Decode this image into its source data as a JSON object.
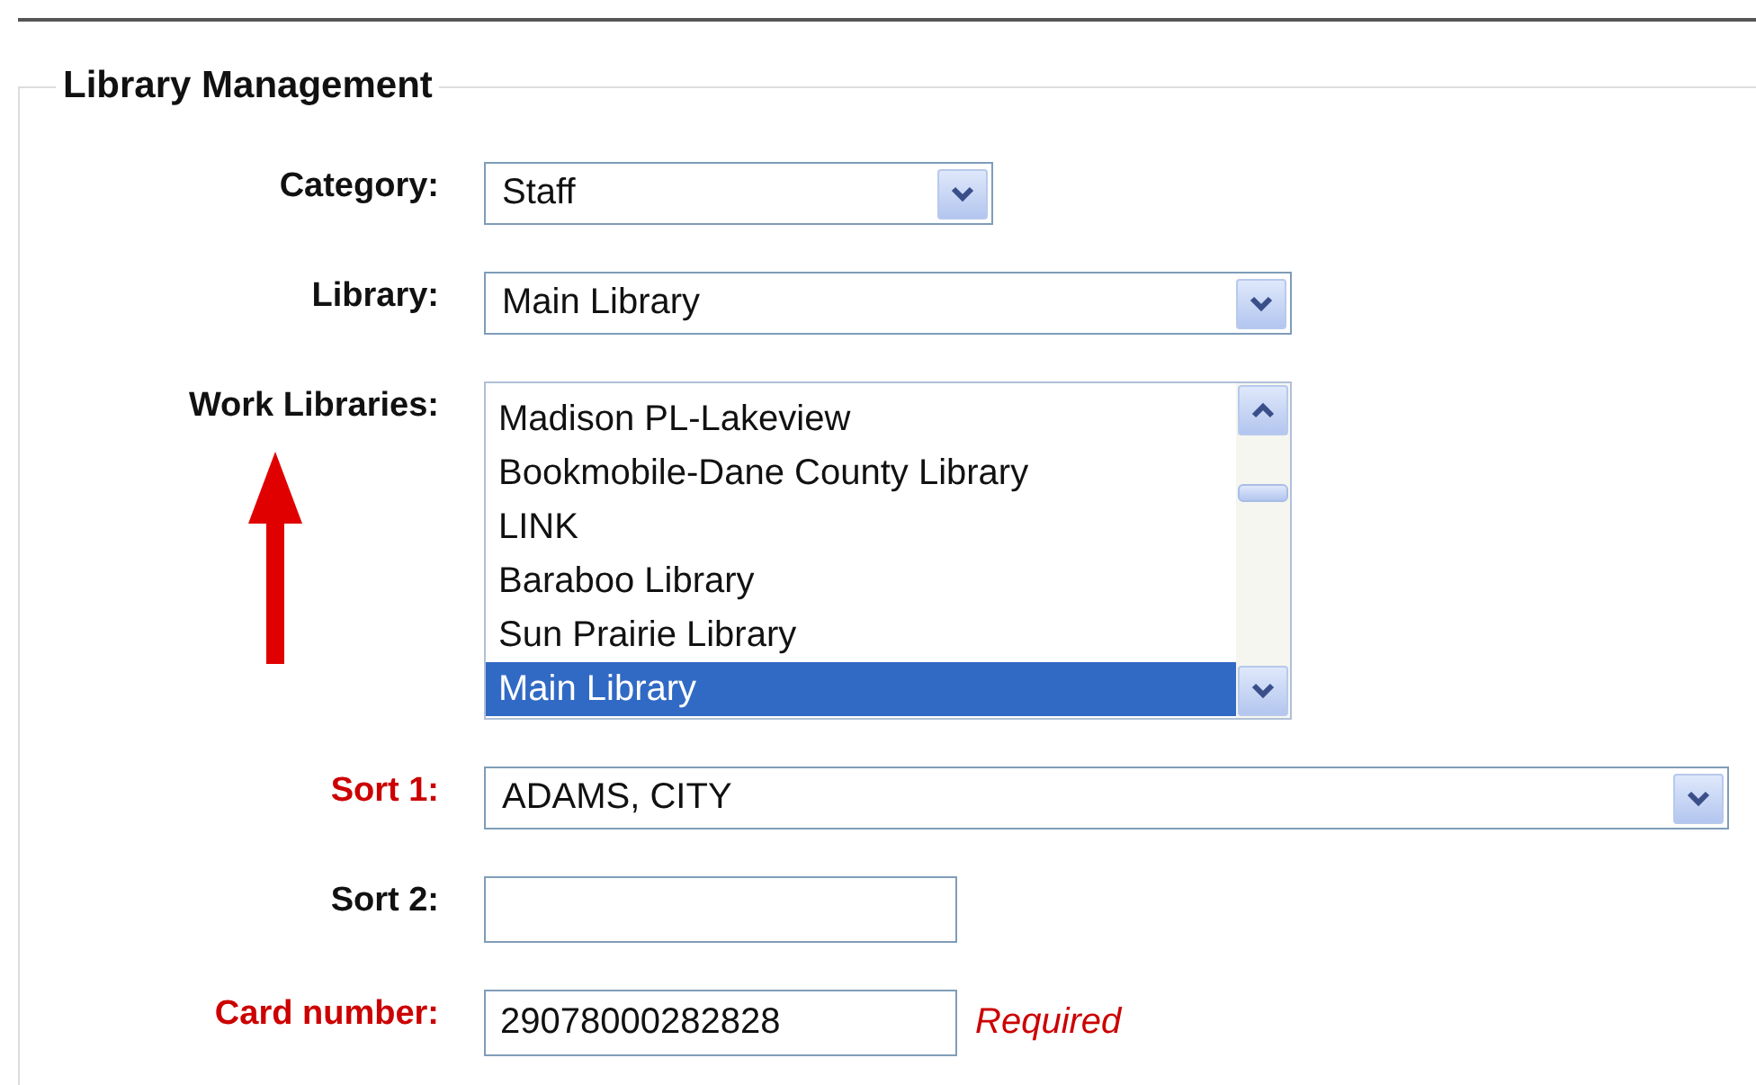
{
  "panel": {
    "title": "Library Management"
  },
  "fields": [
    {
      "kind": "select",
      "label": "Category:",
      "required": false,
      "value": "Staff"
    },
    {
      "kind": "select",
      "label": "Library:",
      "required": false,
      "value": "Main Library"
    },
    {
      "kind": "listbox",
      "label": "Work Libraries:",
      "required": false,
      "options": [
        {
          "label": "Madison PL-Lakeview",
          "selected": false
        },
        {
          "label": "Bookmobile-Dane County Library",
          "selected": false
        },
        {
          "label": "LINK",
          "selected": false
        },
        {
          "label": "Baraboo Library",
          "selected": false
        },
        {
          "label": "Sun Prairie Library",
          "selected": false
        },
        {
          "label": "Main Library",
          "selected": true
        }
      ]
    },
    {
      "kind": "select",
      "label": "Sort 1:",
      "required": true,
      "value": "ADAMS, CITY"
    },
    {
      "kind": "text",
      "label": "Sort 2:",
      "required": false
    },
    {
      "kind": "text",
      "label": "Card number:",
      "required": true,
      "value": "29078000282828",
      "note": "Required"
    }
  ]
}
